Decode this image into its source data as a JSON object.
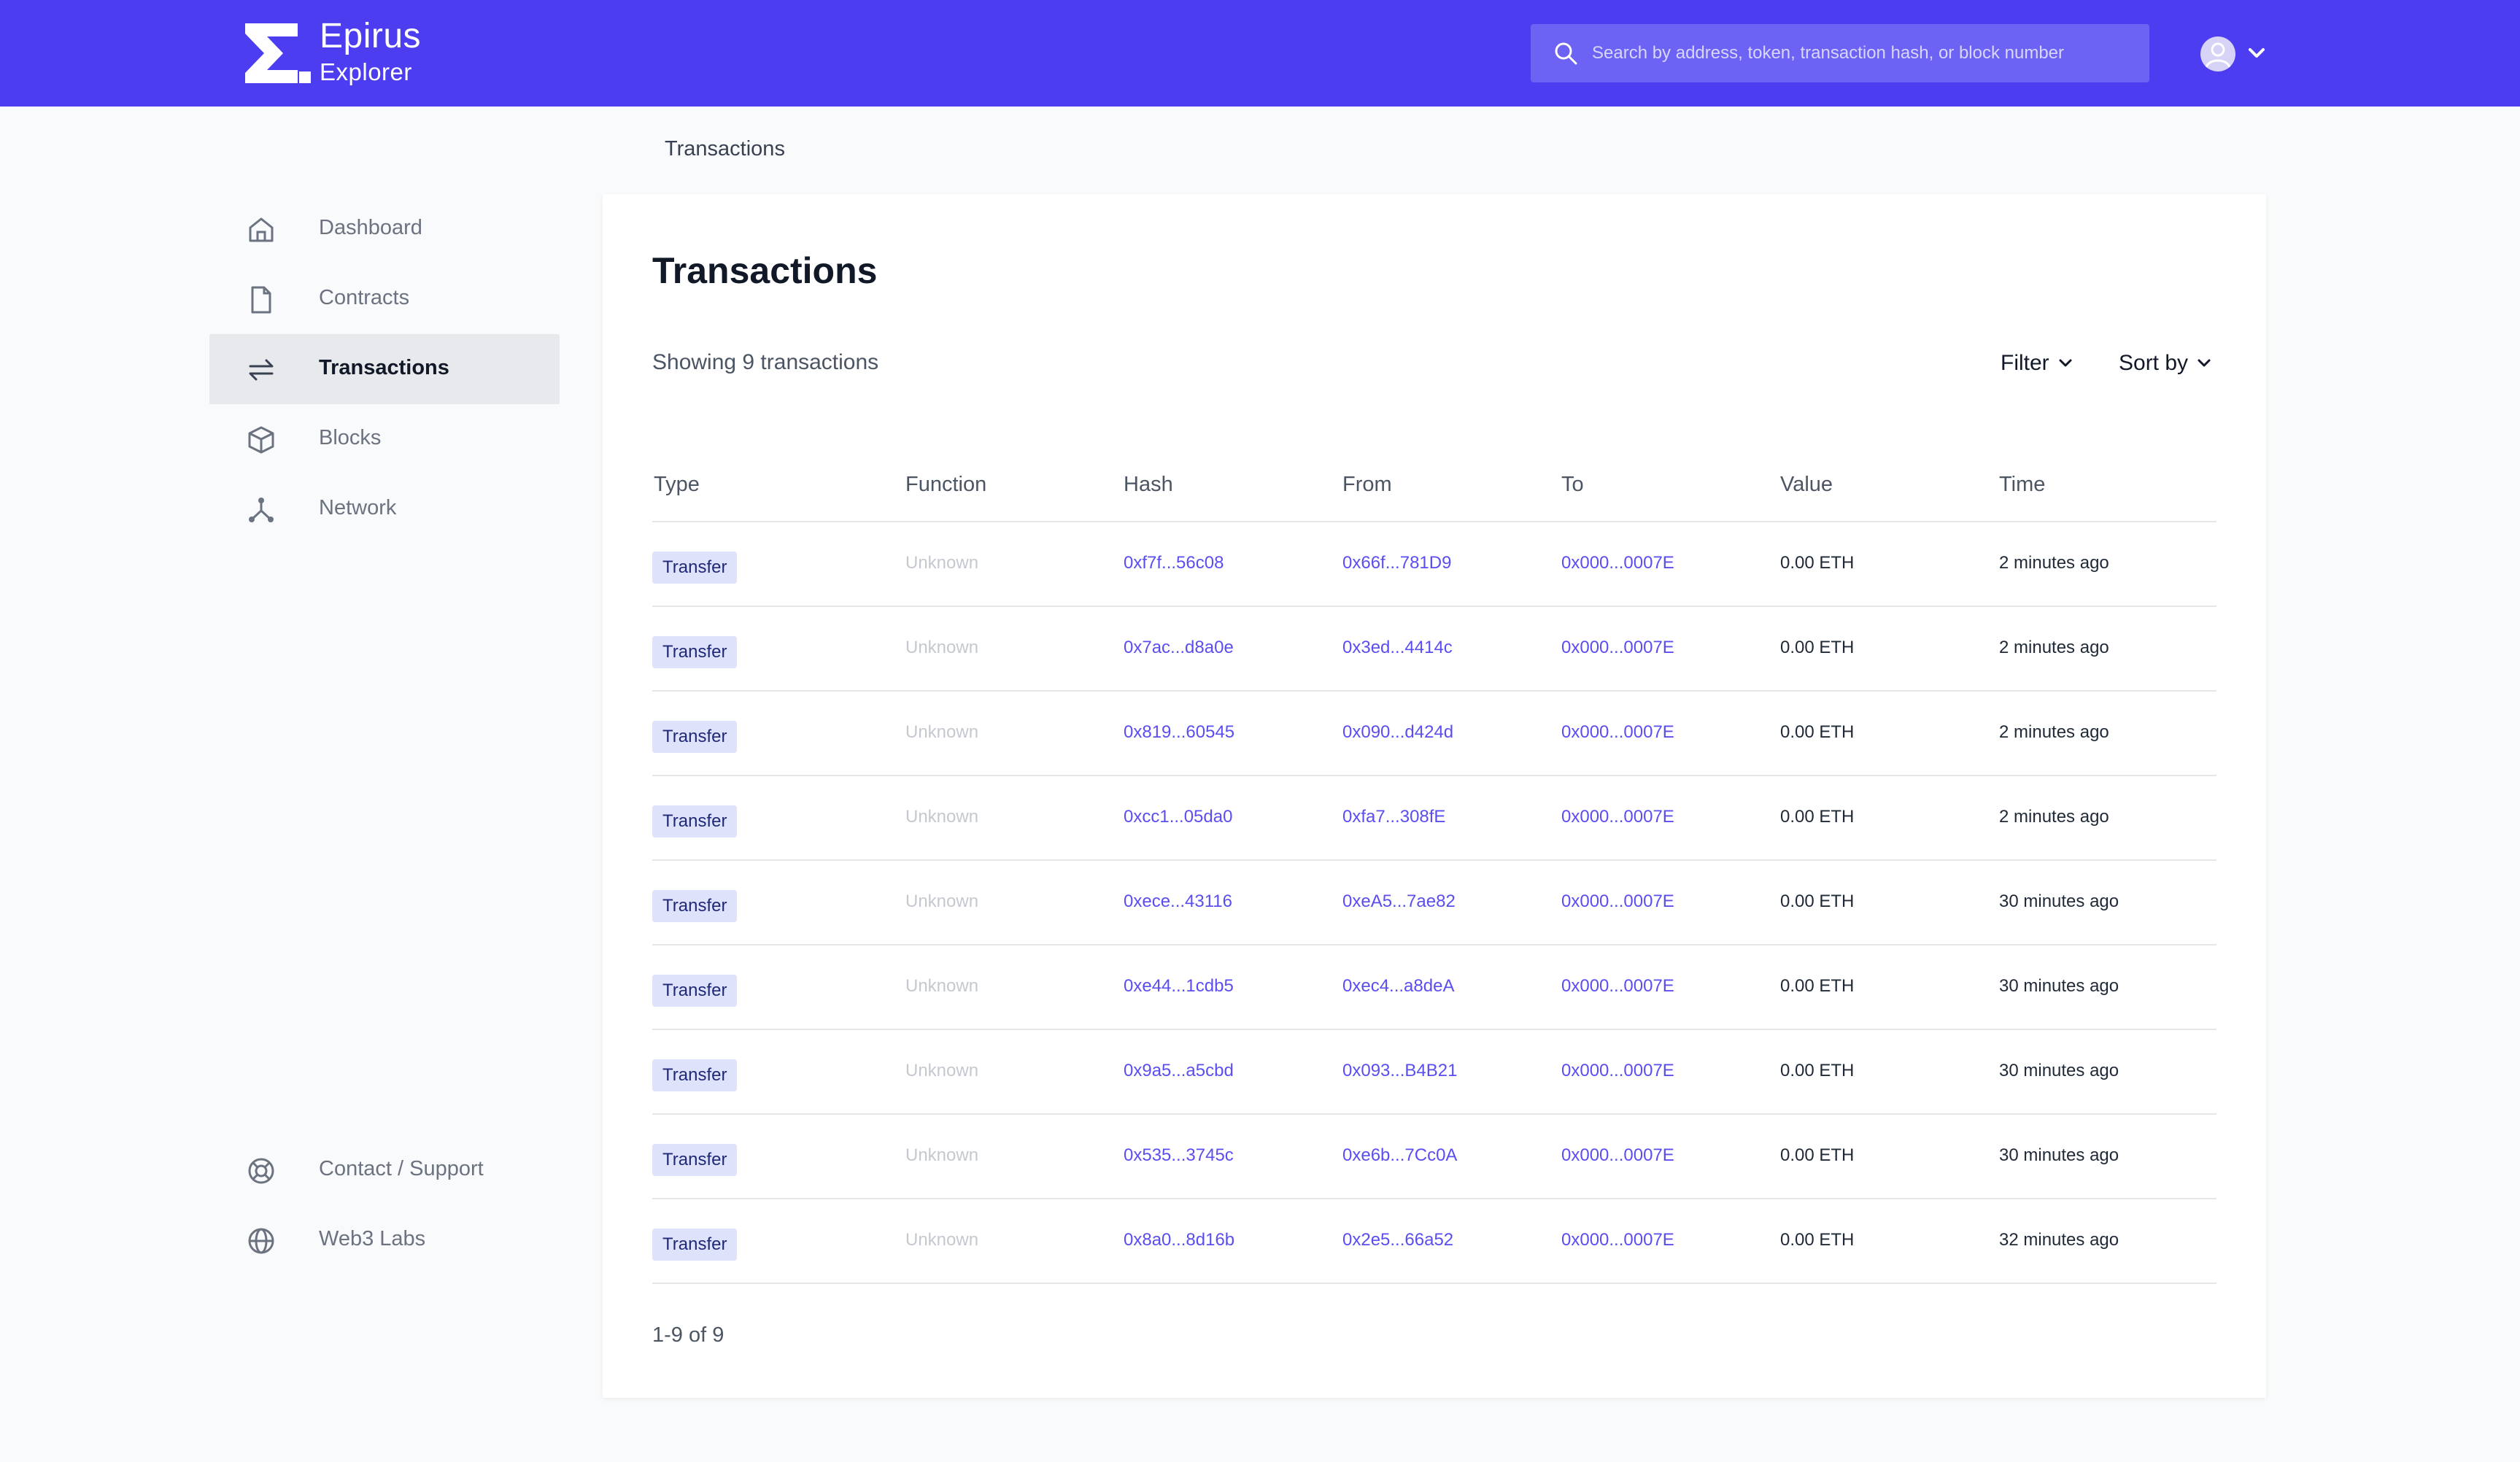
{
  "header": {
    "brand_name": "Epirus",
    "brand_sub": "Explorer",
    "search_placeholder": "Search by address, token, transaction hash, or block number",
    "accent_color": "#4c3ef0"
  },
  "breadcrumb": "Transactions",
  "sidebar": {
    "items": [
      {
        "label": "Dashboard",
        "icon": "home-icon"
      },
      {
        "label": "Contracts",
        "icon": "document-icon"
      },
      {
        "label": "Transactions",
        "icon": "arrows-exchange-icon",
        "active": true
      },
      {
        "label": "Blocks",
        "icon": "cube-icon"
      },
      {
        "label": "Network",
        "icon": "network-icon"
      }
    ],
    "footer_items": [
      {
        "label": "Contact / Support",
        "icon": "lifebuoy-icon"
      },
      {
        "label": "Web3 Labs",
        "icon": "globe-icon"
      }
    ]
  },
  "main": {
    "title": "Transactions",
    "showing": "Showing 9 transactions",
    "filter_label": "Filter",
    "sort_label": "Sort by",
    "columns": [
      "Type",
      "Function",
      "Hash",
      "From",
      "To",
      "Value",
      "Time"
    ],
    "rows": [
      {
        "type": "Transfer",
        "function": "Unknown",
        "hash": "0xf7f...56c08",
        "from": "0x66f...781D9",
        "to": "0x000...0007E",
        "value": "0.00 ETH",
        "time": "2 minutes ago"
      },
      {
        "type": "Transfer",
        "function": "Unknown",
        "hash": "0x7ac...d8a0e",
        "from": "0x3ed...4414c",
        "to": "0x000...0007E",
        "value": "0.00 ETH",
        "time": "2 minutes ago"
      },
      {
        "type": "Transfer",
        "function": "Unknown",
        "hash": "0x819...60545",
        "from": "0x090...d424d",
        "to": "0x000...0007E",
        "value": "0.00 ETH",
        "time": "2 minutes ago"
      },
      {
        "type": "Transfer",
        "function": "Unknown",
        "hash": "0xcc1...05da0",
        "from": "0xfa7...308fE",
        "to": "0x000...0007E",
        "value": "0.00 ETH",
        "time": "2 minutes ago"
      },
      {
        "type": "Transfer",
        "function": "Unknown",
        "hash": "0xece...43116",
        "from": "0xeA5...7ae82",
        "to": "0x000...0007E",
        "value": "0.00 ETH",
        "time": "30 minutes ago"
      },
      {
        "type": "Transfer",
        "function": "Unknown",
        "hash": "0xe44...1cdb5",
        "from": "0xec4...a8deA",
        "to": "0x000...0007E",
        "value": "0.00 ETH",
        "time": "30 minutes ago"
      },
      {
        "type": "Transfer",
        "function": "Unknown",
        "hash": "0x9a5...a5cbd",
        "from": "0x093...B4B21",
        "to": "0x000...0007E",
        "value": "0.00 ETH",
        "time": "30 minutes ago"
      },
      {
        "type": "Transfer",
        "function": "Unknown",
        "hash": "0x535...3745c",
        "from": "0xe6b...7Cc0A",
        "to": "0x000...0007E",
        "value": "0.00 ETH",
        "time": "30 minutes ago"
      },
      {
        "type": "Transfer",
        "function": "Unknown",
        "hash": "0x8a0...8d16b",
        "from": "0x2e5...66a52",
        "to": "0x000...0007E",
        "value": "0.00 ETH",
        "time": "32 minutes ago"
      }
    ],
    "pagination": "1-9 of 9"
  }
}
